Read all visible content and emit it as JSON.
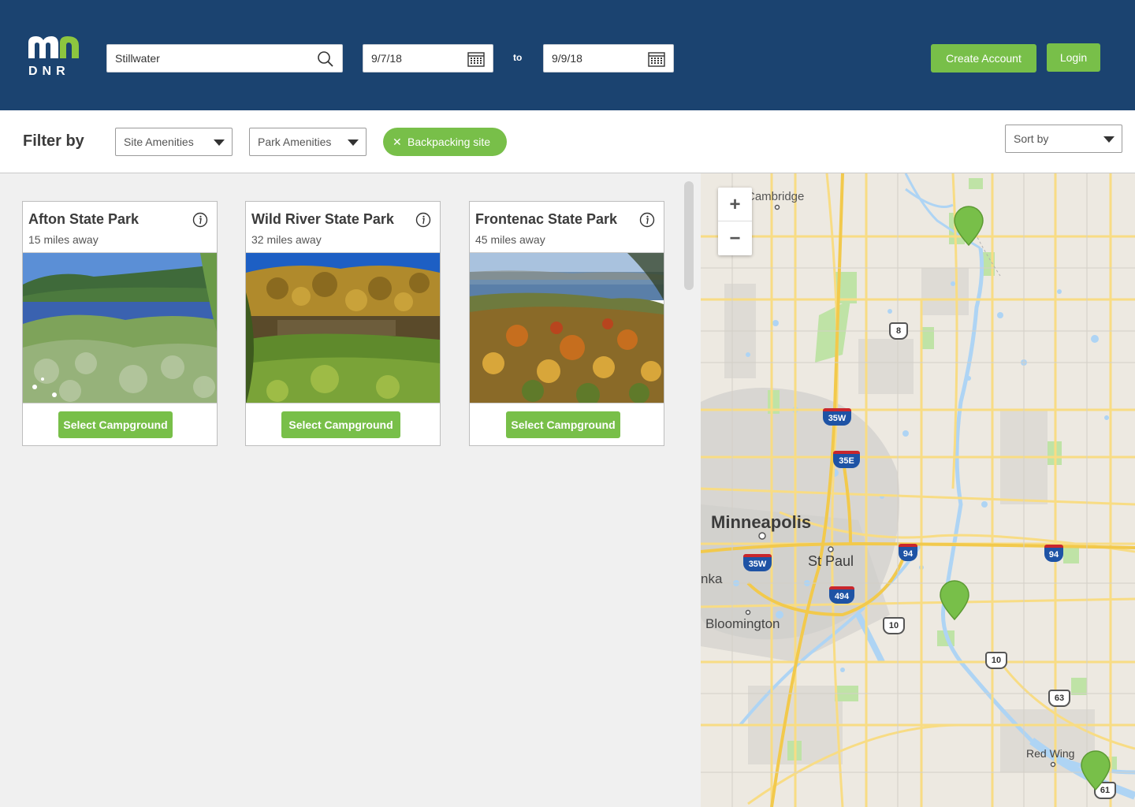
{
  "header": {
    "logo": {
      "mark": "mn",
      "subtext": "DNR"
    },
    "search": {
      "value": "Stillwater",
      "icon": "search-icon"
    },
    "date_from": {
      "value": "9/7/18",
      "icon": "calendar-icon"
    },
    "to_label": "to",
    "date_to": {
      "value": "9/9/18",
      "icon": "calendar-icon"
    },
    "create_account_label": "Create Account",
    "login_label": "Login"
  },
  "filters": {
    "label": "Filter by",
    "site_amenities": "Site Amenities",
    "park_amenities": "Park Amenities",
    "chip": {
      "label": "Backpacking site",
      "remove_icon": "close-icon"
    },
    "sort": "Sort by"
  },
  "parks": [
    {
      "name": "Afton State Park",
      "distance": "15 miles away",
      "button": "Select Campground",
      "icon": "info-icon"
    },
    {
      "name": "Wild River State Park",
      "distance": "32 miles away",
      "button": "Select Campground",
      "icon": "info-icon"
    },
    {
      "name": "Frontenac State Park",
      "distance": "45 miles away",
      "button": "Select Campground",
      "icon": "info-icon"
    }
  ],
  "map": {
    "zoom_in": "+",
    "zoom_out": "−",
    "labels": {
      "cambridge": "Cambridge",
      "minneapolis": "Minneapolis",
      "stpaul": "St Paul",
      "bloomington": "Bloomington",
      "redwing": "Red Wing",
      "nka": "nka"
    },
    "shields": {
      "i35w_n": "35W",
      "i35e": "35E",
      "i35w_s": "35W",
      "i94_w": "94",
      "i94_e": "94",
      "i494": "494",
      "us8": "8",
      "us10_a": "10",
      "us10_b": "10",
      "us63": "63",
      "us61": "61"
    }
  },
  "colors": {
    "header_bg": "#1b4370",
    "accent_green": "#78bf49",
    "logo_green": "#8dc63f"
  }
}
